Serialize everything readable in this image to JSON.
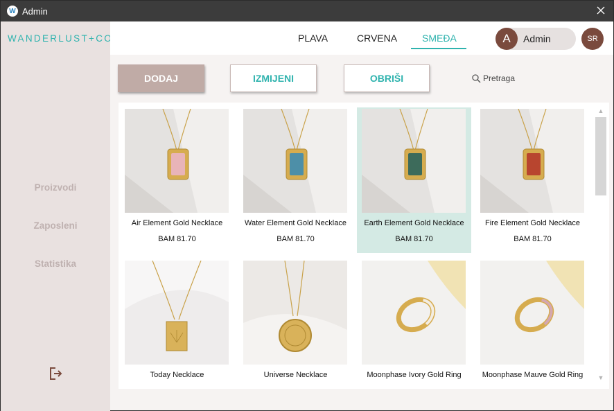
{
  "window": {
    "title": "Admin",
    "app_icon_letter": "W"
  },
  "sidebar": {
    "logo": "WANDERLUST+CO",
    "items": [
      {
        "label": "Proizvodi"
      },
      {
        "label": "Zaposleni"
      },
      {
        "label": "Statistika"
      }
    ]
  },
  "header": {
    "tabs": [
      {
        "label": "PLAVA",
        "active": false
      },
      {
        "label": "CRVENA",
        "active": false
      },
      {
        "label": "SMEĐA",
        "active": true
      }
    ],
    "user": {
      "avatar_letter": "A",
      "name": "Admin"
    },
    "language": "SR"
  },
  "toolbar": {
    "add_label": "DODAJ",
    "edit_label": "IZMIJENI",
    "delete_label": "OBRIŠI",
    "search_placeholder": "Pretraga"
  },
  "products": [
    {
      "name": "Air Element Gold Necklace",
      "price": "BAM 81.70",
      "accent": "#e8b4b8",
      "kind": "tag"
    },
    {
      "name": "Water Element Gold Necklace",
      "price": "BAM 81.70",
      "accent": "#4d8fa8",
      "kind": "tag"
    },
    {
      "name": "Earth Element Gold Necklace",
      "price": "BAM 81.70",
      "accent": "#3d6b5b",
      "kind": "tag"
    },
    {
      "name": "Fire Element Gold Necklace",
      "price": "BAM 81.70",
      "accent": "#b8452f",
      "kind": "tag"
    },
    {
      "name": "Today Necklace",
      "price": "",
      "accent": "#d9b25a",
      "kind": "pendant"
    },
    {
      "name": "Universe Necklace",
      "price": "",
      "accent": "#d9b25a",
      "kind": "coin"
    },
    {
      "name": "Moonphase Ivory Gold Ring",
      "price": "",
      "accent": "#f3ede3",
      "kind": "ring"
    },
    {
      "name": "Moonphase Mauve Gold Ring",
      "price": "",
      "accent": "#d4a7b0",
      "kind": "ring"
    }
  ],
  "selected_product_index": 2,
  "colors": {
    "accent": "#2fb3ae",
    "brown": "#7a4a3d",
    "sidebar_bg": "#e9e1e0",
    "primary_button": "#c0aba6",
    "selected_card": "#d4eae4"
  }
}
